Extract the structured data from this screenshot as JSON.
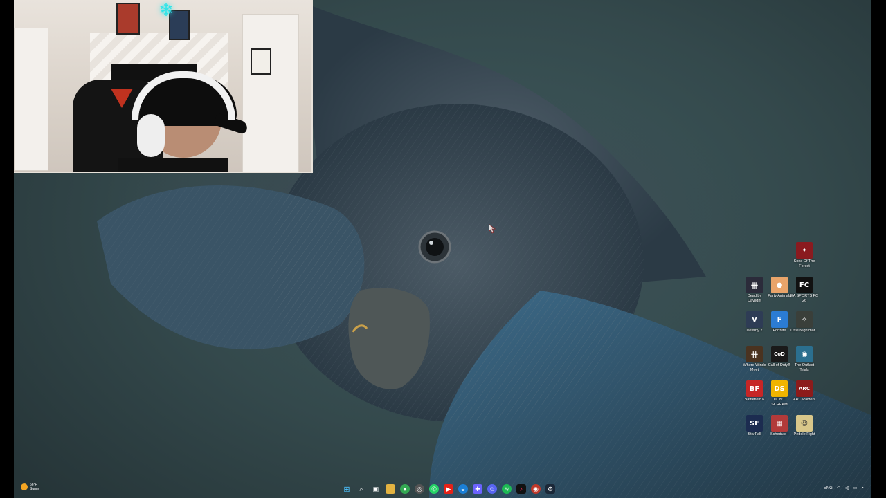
{
  "desktop": {
    "icons": [
      {
        "label": "Sons Of The Forest",
        "color": "#8a1a1f",
        "glyph": "✦"
      },
      {
        "label": "Dead by Daylight",
        "color": "#2b2b3a",
        "glyph": "卌"
      },
      {
        "label": "Party Animals",
        "color": "#e9a46a",
        "glyph": "🐕"
      },
      {
        "label": "EA SPORTS FC 26",
        "color": "#111111",
        "glyph": "FC"
      },
      {
        "label": "Destiny 2",
        "color": "#2e3c55",
        "glyph": "Ⅴ"
      },
      {
        "label": "Fortnite",
        "color": "#2b7cd3",
        "glyph": "F"
      },
      {
        "label": "Little Nightmar...",
        "color": "#3a3f3a",
        "glyph": "✧"
      },
      {
        "label": "Where Winds Meet",
        "color": "#4a3320",
        "glyph": "卄"
      },
      {
        "label": "Call of Duty®",
        "color": "#1a1a1a",
        "glyph": "CoD"
      },
      {
        "label": "The Outlast Trials",
        "color": "#2b6f8f",
        "glyph": "◉"
      },
      {
        "label": "Battlefield 6",
        "color": "#c72626",
        "glyph": "BF"
      },
      {
        "label": "DON'T SCREAM",
        "color": "#f0b400",
        "glyph": "DS"
      },
      {
        "label": "ARC Raiders",
        "color": "#8c1b1b",
        "glyph": "ARC"
      },
      {
        "label": "StarFall",
        "color": "#1c2c50",
        "glyph": "SF"
      },
      {
        "label": "Schedule I",
        "color": "#b23a3a",
        "glyph": "▦"
      },
      {
        "label": "Peddle Fight",
        "color": "#d9c78a",
        "glyph": "☺"
      }
    ]
  },
  "taskbar": {
    "weather": {
      "temp": "66°F",
      "condition": "Sunny"
    },
    "pinned_icons": [
      "start-icon",
      "search-icon",
      "task-view-icon",
      "file-explorer-icon",
      "chrome-icon",
      "obs-icon",
      "whatsapp-icon",
      "youtube-icon",
      "edge-icon",
      "app-icon",
      "discord-icon",
      "spotify-icon",
      "tiktok-icon",
      "screen-recorder-icon",
      "steam-icon"
    ],
    "tray": {
      "language": "ENG"
    }
  },
  "colors": {
    "wallpaper": "#3f5a5d",
    "bird": "#3c4f5c"
  }
}
